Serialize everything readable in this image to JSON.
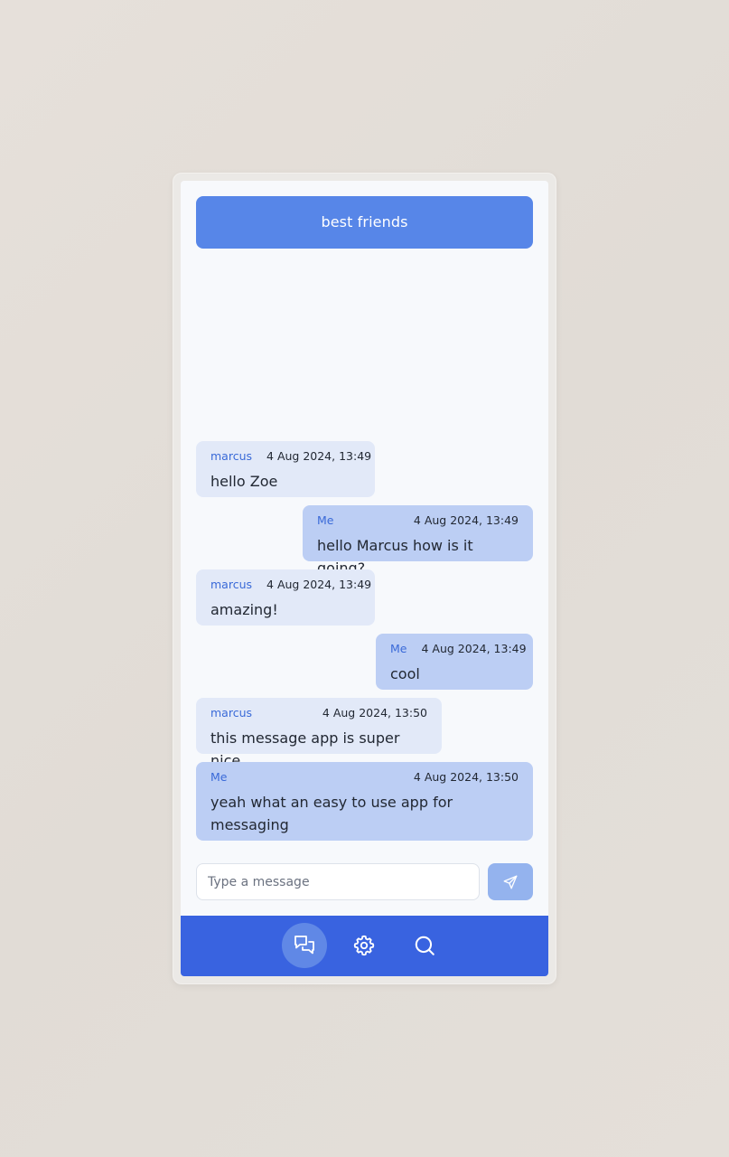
{
  "chat": {
    "title": "best friends"
  },
  "messages": [
    {
      "sender": "marcus",
      "time": "4 Aug 2024, 13:49",
      "text": "hello Zoe",
      "direction": "in"
    },
    {
      "sender": "Me",
      "time": "4 Aug 2024, 13:49",
      "text": "hello Marcus how is it going?",
      "direction": "out"
    },
    {
      "sender": "marcus",
      "time": "4 Aug 2024, 13:49",
      "text": "amazing!",
      "direction": "in"
    },
    {
      "sender": "Me",
      "time": "4 Aug 2024, 13:49",
      "text": "cool",
      "direction": "out"
    },
    {
      "sender": "marcus",
      "time": "4 Aug 2024, 13:50",
      "text": "this message app is super nice",
      "direction": "in"
    },
    {
      "sender": "Me",
      "time": "4 Aug 2024, 13:50",
      "text": "yeah what an easy to use app for messaging",
      "direction": "out"
    }
  ],
  "composer": {
    "placeholder": "Type a message",
    "value": "",
    "send_icon": "send-icon"
  },
  "nav": {
    "items": [
      {
        "icon": "chat-icon",
        "active": true
      },
      {
        "icon": "gear-icon",
        "active": false
      },
      {
        "icon": "search-icon",
        "active": false
      }
    ]
  },
  "colors": {
    "header": "#5786e8",
    "incoming_bubble": "#e2e9f8",
    "outgoing_bubble": "#bccef4",
    "sender_name": "#3a6ad8",
    "navbar": "#3963e0",
    "send_button": "#94b3ee"
  }
}
